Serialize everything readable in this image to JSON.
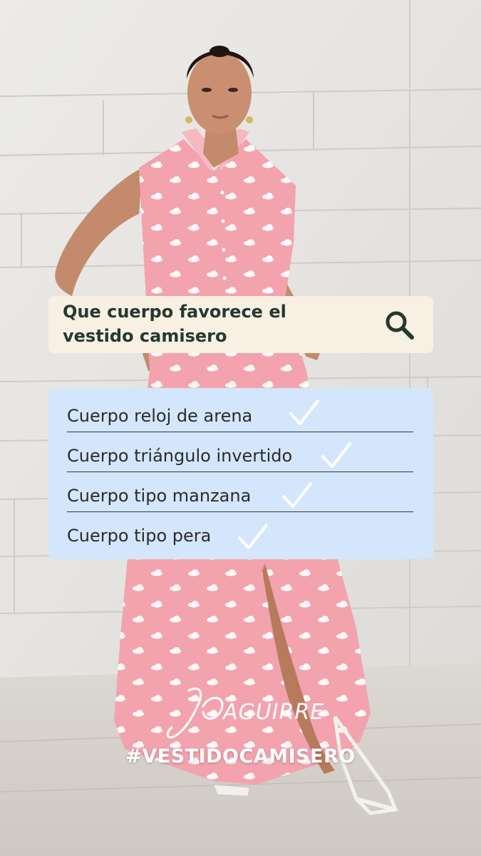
{
  "search": {
    "query": "Que cuerpo favorece el\nvestido camisero",
    "icon": "search-icon"
  },
  "checklist": {
    "items": [
      {
        "label": "Cuerpo reloj de arena"
      },
      {
        "label": "Cuerpo triángulo invertido"
      },
      {
        "label": "Cuerpo tipo manzana"
      },
      {
        "label": "Cuerpo tipo pera"
      }
    ],
    "check_icon": "checkmark-icon"
  },
  "brand": {
    "logo_text": "AGUIRRE",
    "hashtag": "#VESTIDOCAMISERO"
  },
  "colors": {
    "search_bg": "#f7f0e3",
    "list_bg": "#d4e6fb",
    "dress_pink": "#f2a3ae",
    "text_dark": "#24392f"
  }
}
